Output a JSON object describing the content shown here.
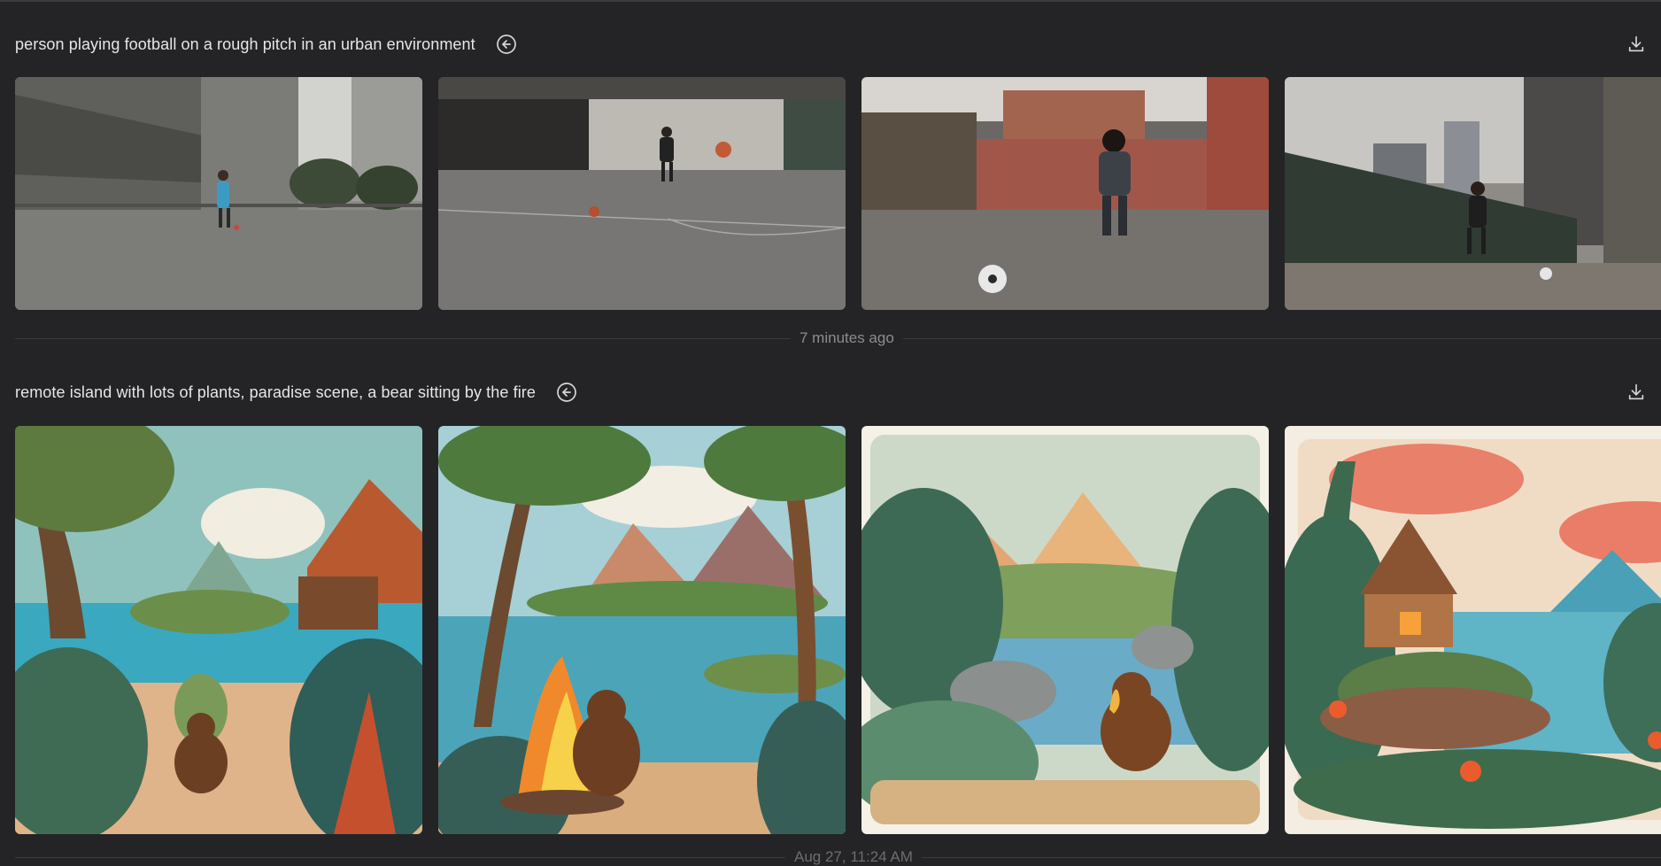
{
  "groups": [
    {
      "prompt": "person playing football on a rough pitch in an urban environment",
      "reuse_icon": "arrow-left-circle-icon",
      "download_icon": "download-icon",
      "images": [
        "football-player-concrete-court",
        "football-player-warehouse-yard",
        "football-player-red-wall-court",
        "football-player-fenced-pitch"
      ]
    },
    {
      "prompt": "remote island with lots of plants, paradise scene, a bear sitting by the fire",
      "reuse_icon": "arrow-left-circle-icon",
      "download_icon": "download-icon",
      "images": [
        "island-bear-hut-beach",
        "island-bear-campfire",
        "island-bear-mountain-lake",
        "island-cabin-seaside"
      ]
    }
  ],
  "dividers": [
    {
      "label": "7 minutes ago"
    },
    {
      "label": "Aug 27, 11:24 AM"
    }
  ],
  "colors": {
    "background": "#242426",
    "text": "#e6e6e8",
    "muted": "#8c8c90"
  }
}
